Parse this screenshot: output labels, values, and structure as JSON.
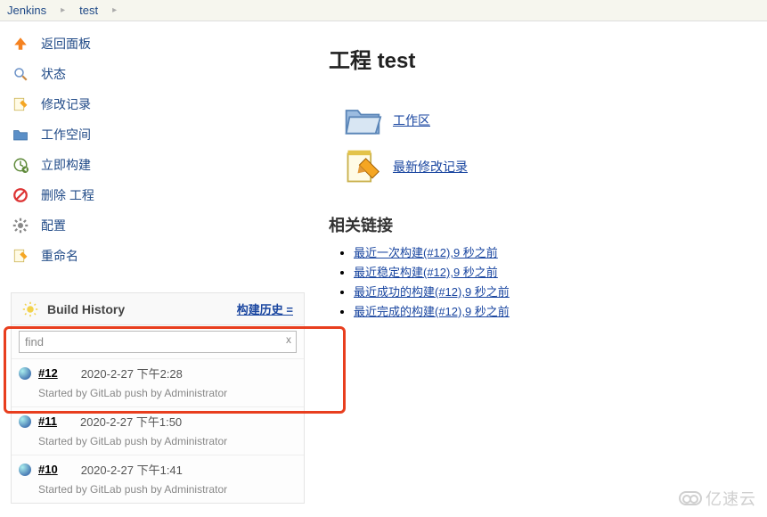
{
  "breadcrumb": {
    "root": "Jenkins",
    "project": "test"
  },
  "sidebar_menu": [
    {
      "label": "返回面板",
      "icon": "up-icon"
    },
    {
      "label": "状态",
      "icon": "search-icon"
    },
    {
      "label": "修改记录",
      "icon": "notepad-icon"
    },
    {
      "label": "工作空间",
      "icon": "folder-icon"
    },
    {
      "label": "立即构建",
      "icon": "clock-icon"
    },
    {
      "label": "删除 工程",
      "icon": "forbid-icon"
    },
    {
      "label": "配置",
      "icon": "gear-icon"
    },
    {
      "label": "重命名",
      "icon": "rename-icon"
    }
  ],
  "build_history": {
    "title": "Build History",
    "trend_label": "构建历史",
    "search_value": "find",
    "clear_label": "x",
    "items": [
      {
        "num": "#12",
        "date": "2020-2-27 下午2:28",
        "cause": "Started by GitLab push by Administrator"
      },
      {
        "num": "#11",
        "date": "2020-2-27 下午1:50",
        "cause": "Started by GitLab push by Administrator"
      },
      {
        "num": "#10",
        "date": "2020-2-27 下午1:41",
        "cause": "Started by GitLab push by Administrator"
      }
    ]
  },
  "main": {
    "title": "工程 test",
    "workspace_link": "工作区",
    "changes_link": "最新修改记录",
    "related_heading": "相关链接",
    "related": [
      "最近一次构建(#12),9 秒之前",
      "最近稳定构建(#12),9 秒之前",
      "最近成功的构建(#12),9 秒之前",
      "最近完成的构建(#12),9 秒之前"
    ]
  },
  "watermark": "亿速云"
}
